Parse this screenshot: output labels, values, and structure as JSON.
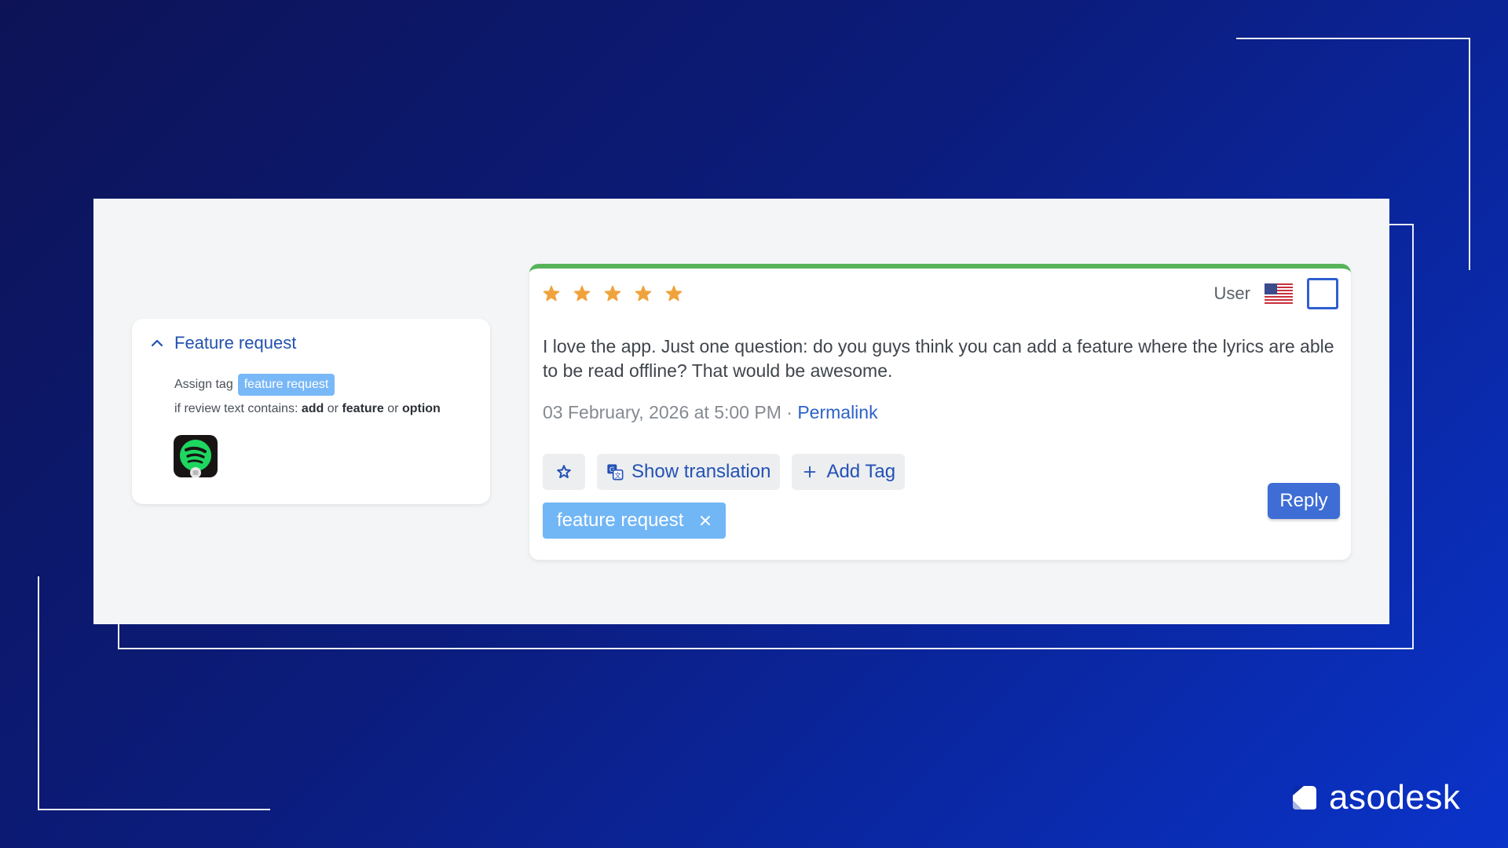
{
  "rule": {
    "title": "Feature request",
    "assign_label": "Assign tag",
    "tag": "feature request",
    "condition_prefix": "if review text contains:",
    "keyword_1": "add",
    "joiner_1": "or",
    "keyword_2": "feature",
    "joiner_2": "or",
    "keyword_3": "option",
    "app_icon": "spotify-icon"
  },
  "review": {
    "rating": 5,
    "author": "User",
    "country_flag": "us-flag-icon",
    "text": "I love the app. Just one question: do you guys think you can add a feature where the lyrics are able to be read offline? That would be awesome.",
    "date": "03 February, 2026 at 5:00 PM",
    "separator": "·",
    "permalink": "Permalink",
    "show_translation": "Show translation",
    "add_tag": "Add Tag",
    "tag": "feature request",
    "reply": "Reply"
  },
  "brand": {
    "name": "asodesk"
  },
  "colors": {
    "accent_blue": "#2251b0",
    "tag_blue": "#71b6f5",
    "star_orange": "#f0a33c",
    "rating_bar_green": "#56b35a",
    "reply_blue": "#3e6dd5",
    "spotify_green": "#1ed760"
  }
}
